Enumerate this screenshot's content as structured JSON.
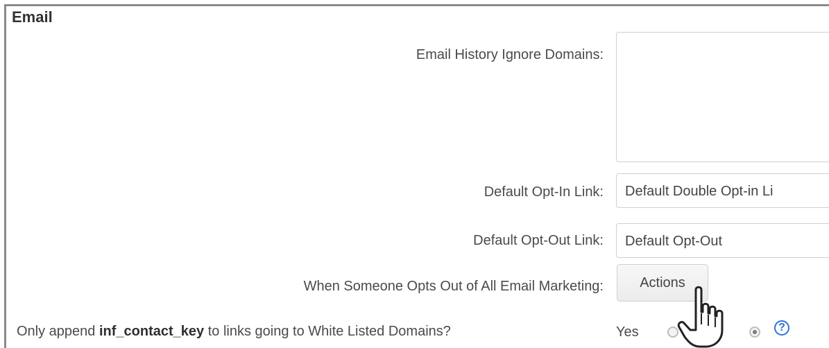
{
  "section": {
    "title": "Email"
  },
  "fields": {
    "ignore_domains": {
      "label": "Email History Ignore Domains:",
      "value": ""
    },
    "opt_in": {
      "label": "Default Opt-In Link:",
      "value": "Default Double Opt-in Li"
    },
    "opt_out": {
      "label": "Default Opt-Out Link:",
      "value": "Default Opt-Out"
    },
    "opts_out_all": {
      "label": "When Someone Opts Out of All Email Marketing:",
      "button": "Actions"
    }
  },
  "append_key": {
    "prefix": "Only append ",
    "key": "inf_contact_key",
    "suffix": " to links going to White Listed Domains?",
    "yes_label": "Yes",
    "help_symbol": "?",
    "selected": "no"
  },
  "colors": {
    "help": "#2a74d8",
    "border": "#8a8a8a"
  }
}
